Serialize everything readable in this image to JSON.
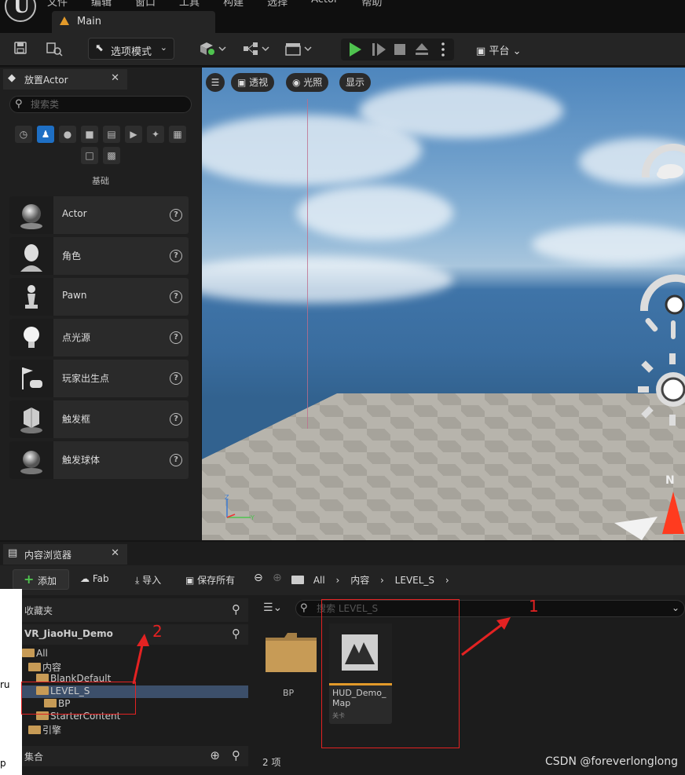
{
  "app": {
    "logo_letter": "U",
    "menu": [
      "文件",
      "编辑",
      "窗口",
      "工具",
      "构建",
      "选择",
      "Actor",
      "帮助"
    ],
    "level_tab": "Main"
  },
  "toolbar": {
    "mode_label": "选项模式",
    "platform_label": "平台"
  },
  "place_actors": {
    "tab_label": "放置Actor",
    "search_placeholder": "搜索类",
    "section_label": "基础",
    "items": [
      {
        "label": "Actor"
      },
      {
        "label": "角色"
      },
      {
        "label": "Pawn"
      },
      {
        "label": "点光源"
      },
      {
        "label": "玩家出生点"
      },
      {
        "label": "触发框"
      },
      {
        "label": "触发球体"
      }
    ]
  },
  "viewport": {
    "perspective_label": "透视",
    "lit_label": "光照",
    "show_label": "显示"
  },
  "content_browser": {
    "tab_label": "内容浏览器",
    "add_label": "添加",
    "fab_label": "Fab",
    "import_label": "导入",
    "save_all_label": "保存所有",
    "breadcrumb": [
      "All",
      "内容",
      "LEVEL_S"
    ],
    "favorites_label": "收藏夹",
    "project_label": "VR_JiaoHu_Demo",
    "tree": [
      "All",
      "内容",
      "BlankDefault",
      "LEVEL_S",
      "BP",
      "StarterContent",
      "引擎"
    ],
    "collections_label": "集合",
    "search_placeholder": "搜索 LEVEL_S",
    "assets": [
      {
        "name": "BP",
        "type": "folder"
      },
      {
        "name": "HUD_Demo_ Map",
        "type_label": "关卡"
      }
    ],
    "item_count": "2 项"
  },
  "overlay": {
    "strip_text_1": "ru",
    "strip_text_2": "p",
    "annotation_1": "1",
    "annotation_2": "2",
    "watermark": "CSDN @foreverlonglong"
  },
  "colors": {
    "accent_orange": "#e39a2a",
    "selection_blue": "#1e6fc4",
    "play_green": "#4fc34f",
    "annotation_red": "#e32222"
  }
}
